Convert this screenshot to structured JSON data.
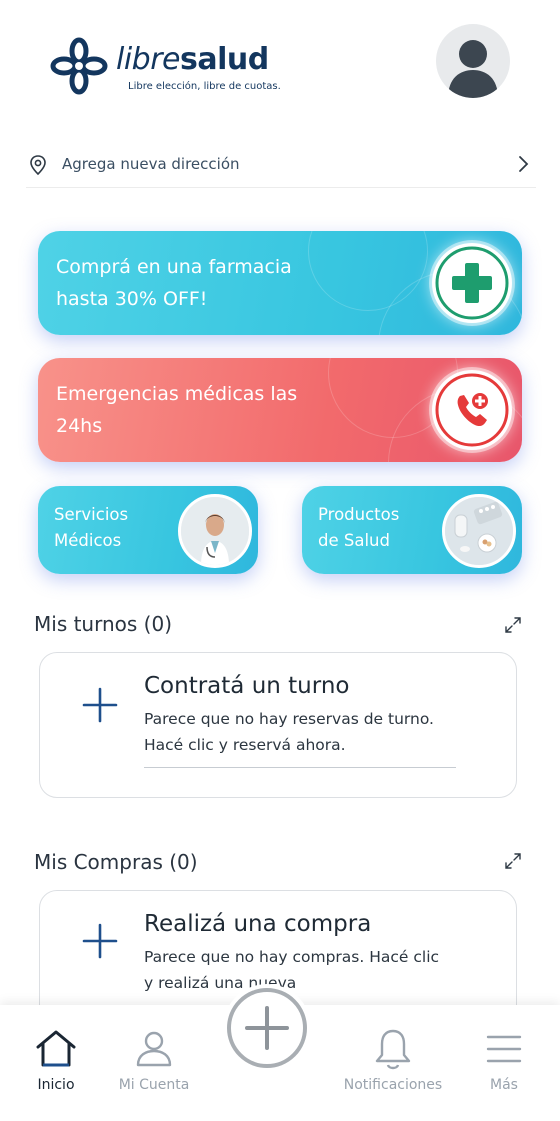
{
  "header": {
    "logo": {
      "libre": "libre",
      "salud": "salud",
      "tagline": "Libre elección, libre de cuotas."
    },
    "avatar_icon": "user-silhouette-icon"
  },
  "address": {
    "label": "Agrega nueva dirección",
    "icon": "location-pin-icon"
  },
  "promos": {
    "pharmacy": {
      "line1": "Comprá en una farmacia",
      "line2": "hasta 30% OFF!",
      "icon": "plus-cross-icon",
      "color": "#1e9d6e"
    },
    "emergency": {
      "line1": "Emergencias médicas las",
      "line2": "24hs",
      "icon": "phone-plus-icon",
      "color": "#e53a3a"
    },
    "services": {
      "line1": "Servicios",
      "line2": "Médicos",
      "icon": "doctor-photo"
    },
    "products": {
      "line1": "Productos",
      "line2": "de Salud",
      "icon": "pills-photo"
    }
  },
  "turnos": {
    "title": "Mis turnos (0)",
    "card_title": "Contratá un turno",
    "desc1": "Parece que no hay reservas de turno.",
    "desc2": "Hacé clic y reservá ahora."
  },
  "compras": {
    "title": "Mis Compras (0)",
    "card_title": "Realizá una compra",
    "desc1": "Parece que no hay compras. Hacé clic",
    "desc2": "y realizá una nueva"
  },
  "nav": {
    "items": [
      {
        "label": "Inicio",
        "icon": "home-icon",
        "active": true
      },
      {
        "label": "Mi Cuenta",
        "icon": "user-icon",
        "active": false
      },
      {
        "label": "Notificaciones",
        "icon": "bell-icon",
        "active": false
      },
      {
        "label": "Más",
        "icon": "menu-icon",
        "active": false
      }
    ],
    "fab_icon": "plus-icon"
  },
  "colors": {
    "brand_navy": "#13365e",
    "accent_blue": "#1e4f8c",
    "card_cyan": "#38c6e0",
    "card_red": "#f26a6c"
  }
}
